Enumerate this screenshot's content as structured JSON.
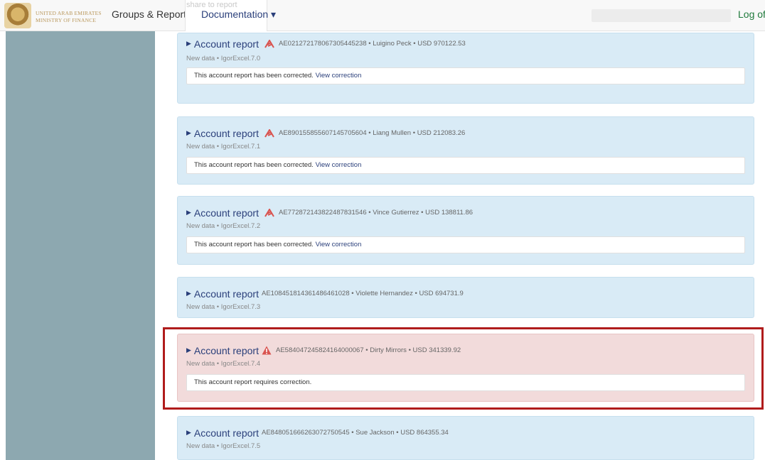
{
  "header": {
    "logo_line1": "UNITED ARAB EMIRATES",
    "logo_line2": "MINISTRY OF FINANCE",
    "nav_groups": "Groups & Reports",
    "nav_documentation": "Documentation ▾",
    "faint_text": "share to report",
    "logoff": "Log off"
  },
  "reports": [
    {
      "title": "Account report",
      "id_and_info": "AE021272178067305445238 • Luigino Peck • USD 970122.53",
      "sub": "New data • IgorExcel.7.0",
      "status": "corrected",
      "notice_text": "This account report has been corrected.",
      "notice_link": "View correction"
    },
    {
      "title": "Account report",
      "id_and_info": "AE890155855607145705604 • Liang Mullen • USD 212083.26",
      "sub": "New data • IgorExcel.7.1",
      "status": "corrected",
      "notice_text": "This account report has been corrected.",
      "notice_link": "View correction"
    },
    {
      "title": "Account report",
      "id_and_info": "AE772872143822487831546 • Vince Gutierrez • USD 138811.86",
      "sub": "New data • IgorExcel.7.2",
      "status": "corrected",
      "notice_text": "This account report has been corrected.",
      "notice_link": "View correction"
    },
    {
      "title": "Account report",
      "id_and_info": "AE108451814361486461028 • Violette Hernandez • USD 694731.9",
      "sub": "New data • IgorExcel.7.3",
      "status": "none"
    },
    {
      "title": "Account report",
      "id_and_info": "AE584047245824164000067 • Dirty Mirrors • USD 341339.92",
      "sub": "New data • IgorExcel.7.4",
      "status": "requires-correction",
      "notice_text": "This account report requires correction."
    },
    {
      "title": "Account report",
      "id_and_info": "AE848051666263072750545 • Sue Jackson • USD 864355.34",
      "sub": "New data • IgorExcel.7.5",
      "status": "none"
    }
  ],
  "colors": {
    "card_bg": "#d9ebf6",
    "error_bg": "#f2dbdb",
    "highlight_border": "#b01c1c",
    "sidebar_bg": "#8da8b0",
    "logoff": "#1f7a3c"
  }
}
